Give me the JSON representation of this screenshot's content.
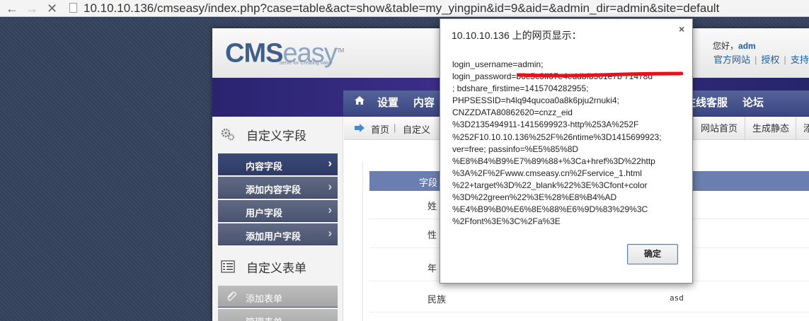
{
  "browser": {
    "back_glyph": "←",
    "forward_glyph": "→",
    "stop_glyph": "✕",
    "url": "10.10.10.136/cmseasy/index.php?case=table&act=show&table=my_yingpin&id=9&aid=&admin_dir=admin&site=default"
  },
  "header": {
    "logo_cms": "CMS",
    "logo_easy": "easy",
    "logo_tm": "TM",
    "logo_tagline": "Serve for Creating value",
    "greeting": "您好，",
    "greeting_user": "adm",
    "links": [
      "官方网站",
      "授权",
      "支持论"
    ]
  },
  "nav": {
    "items": [
      "设置",
      "内容",
      "在线客服",
      "论坛"
    ]
  },
  "sidebar": {
    "section1_title": "自定义字段",
    "section1_items": [
      {
        "label": "内容字段",
        "active": true
      },
      {
        "label": "添加内容字段",
        "active": false
      },
      {
        "label": "用户字段",
        "active": false
      },
      {
        "label": "添加用户字段",
        "active": false
      }
    ],
    "section2_title": "自定义表单",
    "section2_items": [
      {
        "label": "添加表单"
      },
      {
        "label": "管理表单"
      }
    ]
  },
  "breadcrumb": {
    "items": [
      "首页",
      "自定义"
    ],
    "right_buttons": [
      "网站首页",
      "生成静态",
      "添"
    ]
  },
  "table": {
    "header": "字段",
    "rows": [
      {
        "name": "姓",
        "value": ""
      },
      {
        "name": "性",
        "value": ""
      },
      {
        "name": "年",
        "value": ""
      },
      {
        "name": "民族",
        "value": "asd"
      }
    ]
  },
  "dialog": {
    "title": "10.10.10.136 上的网页显示：",
    "close_glyph": "×",
    "message_lines": [
      "login_username=admin;",
      "login_password=b6e5c3ff37e4eddbfb561e7b 71478d",
      "; bdshare_firstime=1415704282955;",
      "PHPSESSID=h4lq94qucoa0a8k6pju2rnuki4;",
      "CNZZDATA80862620=cnzz_eid",
      "%3D2135494911-1415699923-http%253A%252F",
      "%252F10.10.10.136%252F%26ntime%3D1415699923;",
      "ver=free; passinfo=%E5%85%8D",
      "%E8%B4%B9%E7%89%88+%3Ca+href%3D%22http",
      "%3A%2F%2Fwww.cmseasy.cn%2Fservice_1.html",
      "%22+target%3D%22_blank%22%3E%3Cfont+color",
      "%3D%22green%22%3E%28%E8%B4%AD",
      "%E4%B9%B0%E6%8E%88%E6%9D%83%29%3C",
      "%2Ffont%3E%3C%2Fa%3E"
    ],
    "ok_label": "确定"
  },
  "colors": {
    "redaction": "#e8101a",
    "accent_blue": "#1a5ea8",
    "nav_band": "#2a2470",
    "table_header": "#6b7fae",
    "ok_border": "#4d7dc6"
  }
}
